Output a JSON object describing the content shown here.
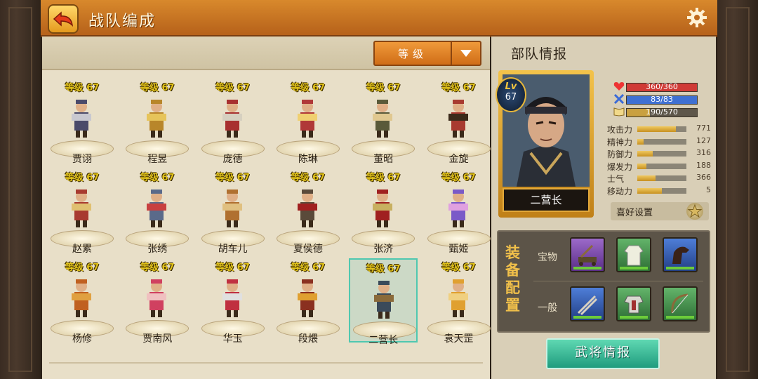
{
  "header": {
    "title": "战队编成"
  },
  "sort": {
    "label": "等级"
  },
  "generals": [
    {
      "level": "等级 67",
      "name": "贾诩"
    },
    {
      "level": "等级 67",
      "name": "程昱"
    },
    {
      "level": "等级 67",
      "name": "庞德"
    },
    {
      "level": "等级 67",
      "name": "陈琳"
    },
    {
      "level": "等级 67",
      "name": "董昭"
    },
    {
      "level": "等级 67",
      "name": "金旋"
    },
    {
      "level": "等级 67",
      "name": "赵累"
    },
    {
      "level": "等级 67",
      "name": "张绣"
    },
    {
      "level": "等级 67",
      "name": "胡车儿"
    },
    {
      "level": "等级 67",
      "name": "夏侯德"
    },
    {
      "level": "等级 67",
      "name": "张济"
    },
    {
      "level": "等级 67",
      "name": "甄姬"
    },
    {
      "level": "等级 67",
      "name": "杨修"
    },
    {
      "level": "等级 67",
      "name": "贾南风"
    },
    {
      "level": "等级 67",
      "name": "华玉"
    },
    {
      "level": "等级 67",
      "name": "段煨"
    },
    {
      "level": "等级 67",
      "name": "二营长"
    },
    {
      "level": "等级 67",
      "name": "袁天罡"
    }
  ],
  "selected_index": 16,
  "unit_info": {
    "title": "部队情报",
    "lv_tag": "Lv",
    "level": "67",
    "name": "二营长",
    "hp": {
      "text": "360/360",
      "fraction": 1.0
    },
    "mp": {
      "text": "83/83",
      "fraction": 1.0
    },
    "exp": {
      "text": "190/570",
      "fraction": 0.333
    },
    "attrs": [
      {
        "label": "攻击力",
        "value": "771",
        "fraction": 0.78
      },
      {
        "label": "精神力",
        "value": "127",
        "fraction": 0.13
      },
      {
        "label": "防御力",
        "value": "316",
        "fraction": 0.32
      },
      {
        "label": "爆发力",
        "value": "188",
        "fraction": 0.19
      },
      {
        "label": "士气",
        "value": "366",
        "fraction": 0.37
      },
      {
        "label": "移动力",
        "value": "5",
        "fraction": 0.5
      }
    ],
    "pref_label": "喜好设置"
  },
  "equipment": {
    "title": "装备配置",
    "title_chars": [
      "装",
      "备",
      "配",
      "置"
    ],
    "treasure_label": "宝物",
    "normal_label": "一般",
    "treasure_slots": [
      {
        "icon": "catapult-icon",
        "rarity": "purple"
      },
      {
        "icon": "robe-icon",
        "rarity": "green"
      },
      {
        "icon": "horse-icon",
        "rarity": "blue"
      }
    ],
    "normal_slots": [
      {
        "icon": "weapon-icon",
        "rarity": "blue"
      },
      {
        "icon": "armor-icon",
        "rarity": "green"
      },
      {
        "icon": "bow-icon",
        "rarity": "green"
      }
    ]
  },
  "general_info_button": "武将情报",
  "colors": {
    "accent": "#d8892c",
    "level_text": "#e1c21a",
    "select_border": "#4fc8b0",
    "button": "#3cc09c"
  }
}
